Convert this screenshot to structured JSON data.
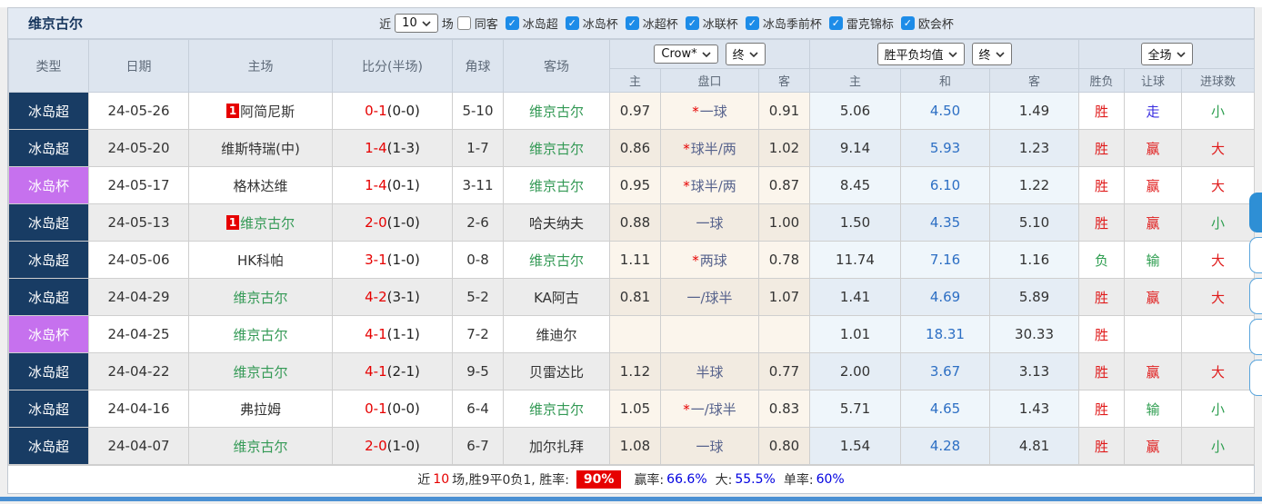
{
  "title": "维京古尔",
  "colors": {
    "league_super_bg": "#183c64",
    "league_cup_bg": "#c671ee",
    "self_team_green": "#339955",
    "score_red": "#e60000",
    "avg_draw_blue": "#2d6fc4",
    "handicap_slate": "#56628c",
    "result_red": "#e01b1b",
    "result_green": "#2e9e50",
    "result_blue": "#3a2ee0",
    "checkbox_blue": "#1d8ce8",
    "bottom_bar_blue": "#4a90d3"
  },
  "filters": {
    "recent_prefix": "近",
    "recent_value": "10",
    "recent_suffix": "场",
    "same_away_label": "同客",
    "check_glyph": "✓",
    "leagues": [
      {
        "label": "冰岛超"
      },
      {
        "label": "冰岛杯"
      },
      {
        "label": "冰超杯"
      },
      {
        "label": "冰联杯"
      },
      {
        "label": "冰岛季前杯"
      },
      {
        "label": "雷克锦标"
      },
      {
        "label": "欧会杯"
      }
    ]
  },
  "table": {
    "headers": {
      "type": "类型",
      "date": "日期",
      "home": "主场",
      "score": "比分(半场)",
      "corner": "角球",
      "away": "客场",
      "odds_home": "主",
      "odds_handicap": "盘口",
      "odds_away": "客",
      "avg_home": "主",
      "avg_draw": "和",
      "avg_away": "客",
      "result_wdl": "胜负",
      "result_handicap": "让球",
      "result_goals": "进球数"
    },
    "selects": {
      "company": "Crow*",
      "company_time": "终",
      "avg": "胜平负均值",
      "avg_time": "终",
      "scope": "全场"
    },
    "rows": [
      {
        "type": "冰岛超",
        "type_style": "background:#183c64;color:#fff",
        "date": "24-05-26",
        "home_badge": "1",
        "home": "阿简尼斯",
        "home_style": "color:#333",
        "score_ft": "0-1",
        "score_ht": "(0-0)",
        "corner": "5-10",
        "away": "维京古尔",
        "away_style": "color:#339955",
        "odds_home": "0.97",
        "handicap_star": "*",
        "handicap": "一球",
        "odds_away": "0.91",
        "avg_home": "5.06",
        "avg_draw": "4.50",
        "avg_away": "1.49",
        "r_wdl": "胜",
        "r_wdl_style": "color:#e01b1b",
        "r_hc": "走",
        "r_hc_style": "color:#3a2ee0",
        "r_goal": "小",
        "r_goal_style": "color:#2e9e50"
      },
      {
        "type": "冰岛超",
        "type_style": "background:#183c64;color:#fff",
        "date": "24-05-20",
        "home_badge": "",
        "home": "维斯特瑞(中)",
        "home_style": "color:#333",
        "score_ft": "1-4",
        "score_ht": "(1-3)",
        "corner": "1-7",
        "away": "维京古尔",
        "away_style": "color:#339955",
        "odds_home": "0.86",
        "handicap_star": "*",
        "handicap": "球半/两",
        "odds_away": "1.02",
        "avg_home": "9.14",
        "avg_draw": "5.93",
        "avg_away": "1.23",
        "r_wdl": "胜",
        "r_wdl_style": "color:#e01b1b",
        "r_hc": "赢",
        "r_hc_style": "color:#e01b1b",
        "r_goal": "大",
        "r_goal_style": "color:#e01b1b"
      },
      {
        "type": "冰岛杯",
        "type_style": "background:#c671ee;color:#fff",
        "date": "24-05-17",
        "home_badge": "",
        "home": "格林达维",
        "home_style": "color:#333",
        "score_ft": "1-4",
        "score_ht": "(0-1)",
        "corner": "3-11",
        "away": "维京古尔",
        "away_style": "color:#339955",
        "odds_home": "0.95",
        "handicap_star": "*",
        "handicap": "球半/两",
        "odds_away": "0.87",
        "avg_home": "8.45",
        "avg_draw": "6.10",
        "avg_away": "1.22",
        "r_wdl": "胜",
        "r_wdl_style": "color:#e01b1b",
        "r_hc": "赢",
        "r_hc_style": "color:#e01b1b",
        "r_goal": "大",
        "r_goal_style": "color:#e01b1b"
      },
      {
        "type": "冰岛超",
        "type_style": "background:#183c64;color:#fff",
        "date": "24-05-13",
        "home_badge": "1",
        "home": "维京古尔",
        "home_style": "color:#339955",
        "score_ft": "2-0",
        "score_ht": "(1-0)",
        "corner": "2-6",
        "away": "哈夫纳夫",
        "away_style": "color:#333",
        "odds_home": "0.88",
        "handicap_star": "",
        "handicap": "一球",
        "odds_away": "1.00",
        "avg_home": "1.50",
        "avg_draw": "4.35",
        "avg_away": "5.10",
        "r_wdl": "胜",
        "r_wdl_style": "color:#e01b1b",
        "r_hc": "赢",
        "r_hc_style": "color:#e01b1b",
        "r_goal": "小",
        "r_goal_style": "color:#2e9e50"
      },
      {
        "type": "冰岛超",
        "type_style": "background:#183c64;color:#fff",
        "date": "24-05-06",
        "home_badge": "",
        "home": "HK科帕",
        "home_style": "color:#333",
        "score_ft": "3-1",
        "score_ht": "(1-0)",
        "corner": "0-8",
        "away": "维京古尔",
        "away_style": "color:#339955",
        "odds_home": "1.11",
        "handicap_star": "*",
        "handicap": "两球",
        "odds_away": "0.78",
        "avg_home": "11.74",
        "avg_draw": "7.16",
        "avg_away": "1.16",
        "r_wdl": "负",
        "r_wdl_style": "color:#2e9e50",
        "r_hc": "输",
        "r_hc_style": "color:#2e9e50",
        "r_goal": "大",
        "r_goal_style": "color:#e01b1b"
      },
      {
        "type": "冰岛超",
        "type_style": "background:#183c64;color:#fff",
        "date": "24-04-29",
        "home_badge": "",
        "home": "维京古尔",
        "home_style": "color:#339955",
        "score_ft": "4-2",
        "score_ht": "(3-1)",
        "corner": "5-2",
        "away": "KA阿古",
        "away_style": "color:#333",
        "odds_home": "0.81",
        "handicap_star": "",
        "handicap": "一/球半",
        "odds_away": "1.07",
        "avg_home": "1.41",
        "avg_draw": "4.69",
        "avg_away": "5.89",
        "r_wdl": "胜",
        "r_wdl_style": "color:#e01b1b",
        "r_hc": "赢",
        "r_hc_style": "color:#e01b1b",
        "r_goal": "大",
        "r_goal_style": "color:#e01b1b"
      },
      {
        "type": "冰岛杯",
        "type_style": "background:#c671ee;color:#fff",
        "date": "24-04-25",
        "home_badge": "",
        "home": "维京古尔",
        "home_style": "color:#339955",
        "score_ft": "4-1",
        "score_ht": "(1-1)",
        "corner": "7-2",
        "away": "维迪尔",
        "away_style": "color:#333",
        "odds_home": "",
        "handicap_star": "",
        "handicap": "",
        "odds_away": "",
        "avg_home": "1.01",
        "avg_draw": "18.31",
        "avg_away": "30.33",
        "r_wdl": "胜",
        "r_wdl_style": "color:#e01b1b",
        "r_hc": "",
        "r_hc_style": "",
        "r_goal": "",
        "r_goal_style": ""
      },
      {
        "type": "冰岛超",
        "type_style": "background:#183c64;color:#fff",
        "date": "24-04-22",
        "home_badge": "",
        "home": "维京古尔",
        "home_style": "color:#339955",
        "score_ft": "4-1",
        "score_ht": "(2-1)",
        "corner": "9-5",
        "away": "贝雷达比",
        "away_style": "color:#333",
        "odds_home": "1.12",
        "handicap_star": "",
        "handicap": "半球",
        "odds_away": "0.77",
        "avg_home": "2.00",
        "avg_draw": "3.67",
        "avg_away": "3.13",
        "r_wdl": "胜",
        "r_wdl_style": "color:#e01b1b",
        "r_hc": "赢",
        "r_hc_style": "color:#e01b1b",
        "r_goal": "大",
        "r_goal_style": "color:#e01b1b"
      },
      {
        "type": "冰岛超",
        "type_style": "background:#183c64;color:#fff",
        "date": "24-04-16",
        "home_badge": "",
        "home": "弗拉姆",
        "home_style": "color:#333",
        "score_ft": "0-1",
        "score_ht": "(0-0)",
        "corner": "6-4",
        "away": "维京古尔",
        "away_style": "color:#339955",
        "odds_home": "1.05",
        "handicap_star": "*",
        "handicap": "一/球半",
        "odds_away": "0.83",
        "avg_home": "5.71",
        "avg_draw": "4.65",
        "avg_away": "1.43",
        "r_wdl": "胜",
        "r_wdl_style": "color:#e01b1b",
        "r_hc": "输",
        "r_hc_style": "color:#2e9e50",
        "r_goal": "小",
        "r_goal_style": "color:#2e9e50"
      },
      {
        "type": "冰岛超",
        "type_style": "background:#183c64;color:#fff",
        "date": "24-04-07",
        "home_badge": "",
        "home": "维京古尔",
        "home_style": "color:#339955",
        "score_ft": "2-0",
        "score_ht": "(1-0)",
        "corner": "6-7",
        "away": "加尔扎拜",
        "away_style": "color:#333",
        "odds_home": "1.08",
        "handicap_star": "",
        "handicap": "一球",
        "odds_away": "0.80",
        "avg_home": "1.54",
        "avg_draw": "4.28",
        "avg_away": "4.81",
        "r_wdl": "胜",
        "r_wdl_style": "color:#e01b1b",
        "r_hc": "赢",
        "r_hc_style": "color:#e01b1b",
        "r_goal": "小",
        "r_goal_style": "color:#2e9e50"
      }
    ]
  },
  "summary": {
    "prefix": "近",
    "count": "10",
    "mid": "场,胜9平0负1, 胜率:",
    "win_rate": "90%",
    "stat1_label": "赢率:",
    "stat1_value": "66.6%",
    "stat2_label": "大:",
    "stat2_value": "55.5%",
    "stat3_label": "单率:",
    "stat3_value": "60%"
  }
}
